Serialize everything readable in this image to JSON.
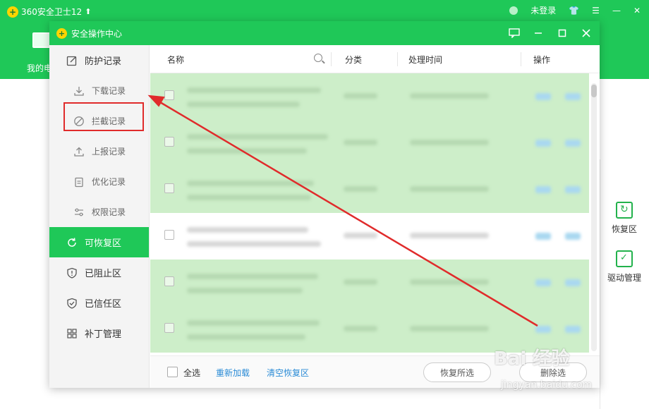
{
  "app": {
    "title": "360安全卫士12",
    "login_label": "未登录",
    "mypc_label": "我的电",
    "right_tools": [
      {
        "label": "恢复区"
      },
      {
        "label": "驱动管理"
      }
    ]
  },
  "dialog": {
    "title": "安全操作中心"
  },
  "sidebar": {
    "items": [
      {
        "label": "防护记录"
      },
      {
        "label": "下载记录"
      },
      {
        "label": "拦截记录"
      },
      {
        "label": "上报记录"
      },
      {
        "label": "优化记录"
      },
      {
        "label": "权限记录"
      },
      {
        "label": "可恢复区"
      },
      {
        "label": "已阻止区"
      },
      {
        "label": "已信任区"
      },
      {
        "label": "补丁管理"
      }
    ]
  },
  "table": {
    "columns": {
      "name": "名称",
      "category": "分类",
      "time": "处理时间",
      "action": "操作"
    }
  },
  "footer": {
    "select_all": "全选",
    "reload": "重新加载",
    "clear": "清空恢复区",
    "restore_selected": "恢复所选",
    "partial_button": "删除选"
  },
  "watermark": {
    "main": "Bai 经验",
    "sub": "jingyan.baidu.com"
  },
  "colors": {
    "brand_green": "#1fc858",
    "row_green": "#cdeec9",
    "highlight_red": "#e02b2b",
    "link_blue": "#2a8bd6"
  }
}
